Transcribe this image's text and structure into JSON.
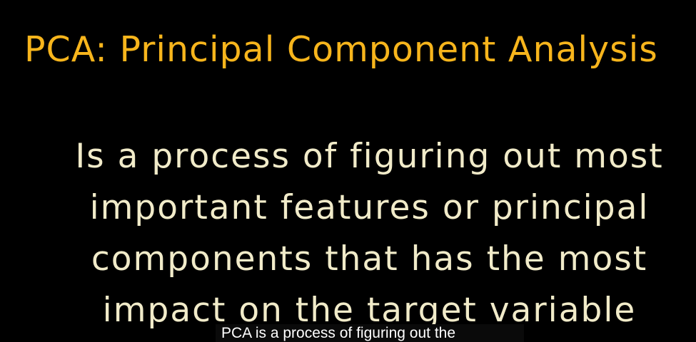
{
  "slide": {
    "title": "PCA: Principal Component Analysis",
    "body_lines": [
      "Is a process of figuring out most",
      "important features or principal",
      "components that has the most",
      "impact on the target variable"
    ],
    "title_color": "#f7b51c",
    "body_color": "#f1ebc9",
    "background_color": "#000000"
  },
  "caption": {
    "text": "PCA is a process of figuring out the"
  }
}
